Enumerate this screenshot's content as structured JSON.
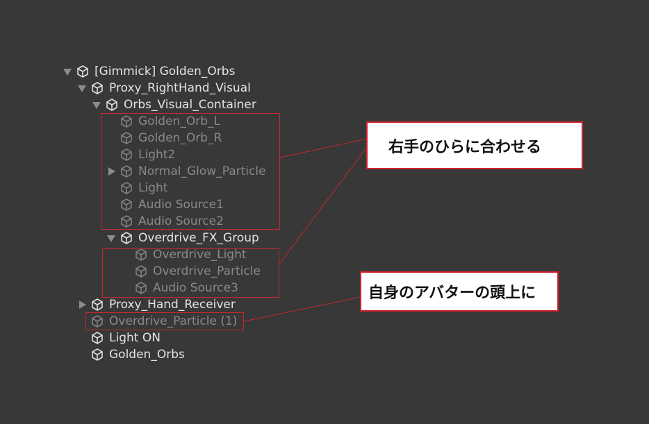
{
  "hierarchy": {
    "root": {
      "label": "[Gimmick] Golden_Orbs"
    },
    "proxy_right_hand": {
      "label": "Proxy_RightHand_Visual"
    },
    "orbs_container": {
      "label": "Orbs_Visual_Container"
    },
    "golden_orb_l": {
      "label": "Golden_Orb_L"
    },
    "golden_orb_r": {
      "label": "Golden_Orb_R"
    },
    "light2": {
      "label": "Light2"
    },
    "normal_glow": {
      "label": "Normal_Glow_Particle"
    },
    "light": {
      "label": "Light"
    },
    "audio1": {
      "label": "Audio Source1"
    },
    "audio2": {
      "label": "Audio Source2"
    },
    "overdrive_group": {
      "label": "Overdrive_FX_Group"
    },
    "overdrive_light": {
      "label": "Overdrive_Light"
    },
    "overdrive_particle": {
      "label": "Overdrive_Particle"
    },
    "audio3": {
      "label": "Audio Source3"
    },
    "proxy_hand_receiver": {
      "label": "Proxy_Hand_Receiver"
    },
    "overdrive_particle_1": {
      "label": "Overdrive_Particle (1)"
    },
    "light_on": {
      "label": "Light ON"
    },
    "golden_orbs": {
      "label": "Golden_Orbs"
    }
  },
  "annotations": {
    "palm": {
      "text": "右手のひらに合わせる"
    },
    "head": {
      "text": "自身のアバターの頭上に"
    }
  },
  "colors": {
    "background": "#383838",
    "active_text": "#e3e3e3",
    "inactive_text": "#8a8a8a",
    "annotation_border": "#d0232a"
  }
}
